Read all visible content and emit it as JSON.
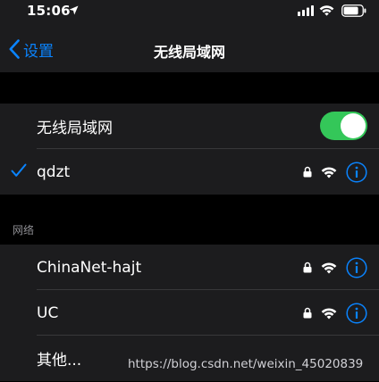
{
  "status_bar": {
    "time": "15:06"
  },
  "nav": {
    "back_label": "设置",
    "title": "无线局域网"
  },
  "wifi_toggle": {
    "label": "无线局域网",
    "on": true
  },
  "connected": {
    "name": "qdzt",
    "secured": true
  },
  "section_header": "网络",
  "networks": [
    {
      "name": "ChinaNet-hajt",
      "secured": true
    },
    {
      "name": "UC",
      "secured": true
    }
  ],
  "other_label": "其他...",
  "watermark": "https://blog.csdn.net/weixin_45020839",
  "colors": {
    "accent": "#0a84ff",
    "toggle_on": "#34c759",
    "row_bg": "#1c1c1e",
    "background": "#000000"
  }
}
